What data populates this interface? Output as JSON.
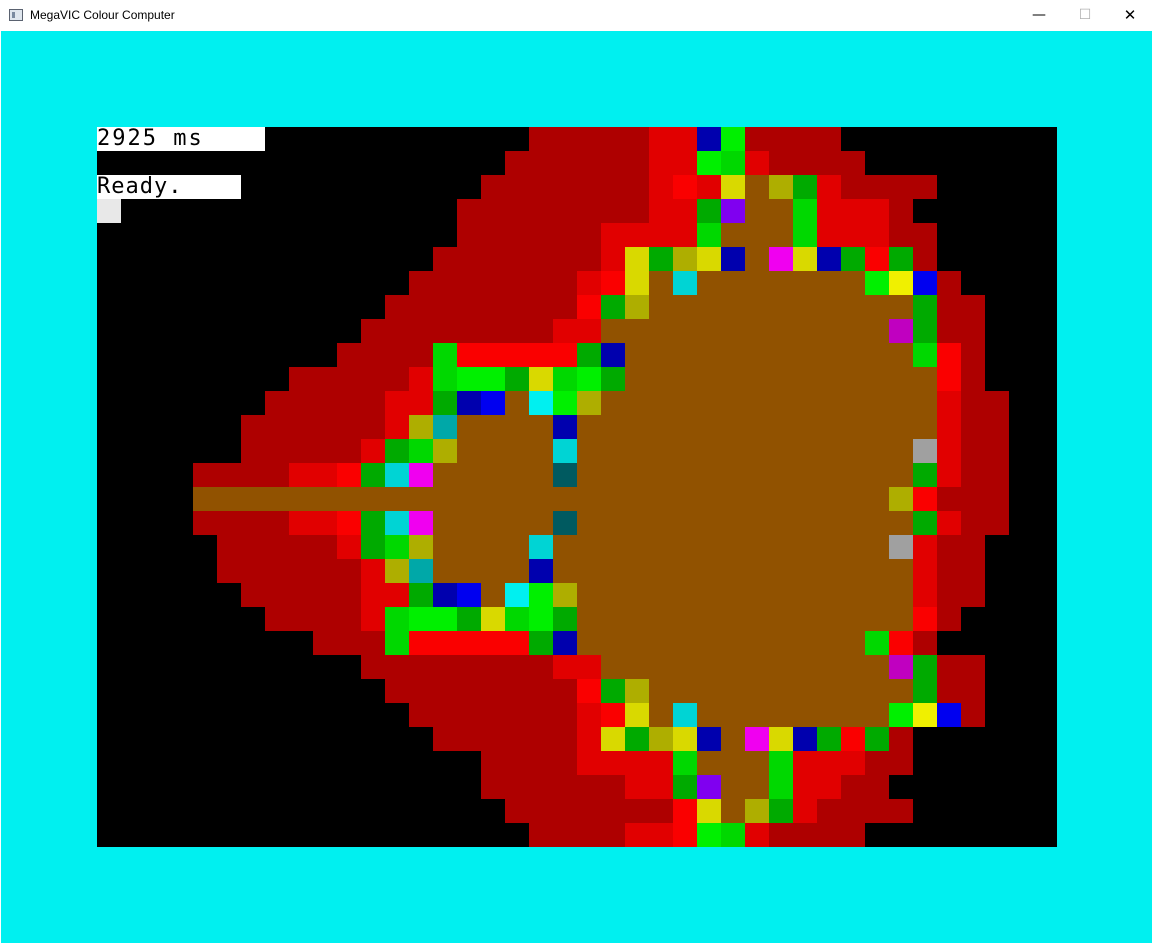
{
  "window": {
    "title": "MegaVIC Colour Computer",
    "icon": "app-window-icon",
    "controls": {
      "minimize_glyph": "—",
      "maximize_glyph": "☐",
      "close_glyph": "✕"
    }
  },
  "screen": {
    "border_color": "#00f0f0",
    "background_color": "#000000",
    "timing_text": "2925 ms",
    "status_text": "Ready.",
    "palette": {
      "K": "#000000",
      "D": "#ae0000",
      "r": "#c80000",
      "R": "#e10000",
      "E": "#fa0000",
      "B": "#915200",
      "Y": "#aeae00",
      "y": "#d9d900",
      "L": "#f0f000",
      "G": "#00aa00",
      "g": "#00d800",
      "l": "#00f000",
      "N": "#0000ae",
      "U": "#0000f0",
      "C": "#00a8a8",
      "c": "#00d4d4",
      "A": "#00f0f0",
      "T": "#005a60",
      "M": "#c000c0",
      "m": "#f000f0",
      "P": "#8000f0",
      "W": "#a0a0a0"
    },
    "fractal_rows": [
      "KKKKKKKKKKKKKKKKKKKKDDDDDRRNlDDDDKKKKKKKKKKKKKKK",
      "KKKKKKKKKKKKKKKKKKKDDDDDDRRlgRDDDDKKKKKKKKKKKKKK",
      "KKKKKKKKKKKKKKKKKKDDDDDDDRERyBYGRDDDDKKKKKKKKKKK",
      "KKKKKKKKKKKKKKKKKDDDDDDDDRRGPBBgRRRDKKKKKKKKKKKK",
      "KKKKKKKKKKKKKKKKKDDDDDDRRRRgBBBgRRRDDKKKKKKKKKKK",
      "KKKKKKKKKKKKKKKKDDDDDDDRyGYyNBmyNGEGDKKKKKKKKKKK",
      "KKKKKKKKKKKKKKKDDDDDDDREyBcBBBBBBBlLUDKKKKKKKKKK",
      "KKKKKKKKKKKKKKDDDDDDDDEGYBBBBBBBBBBBGDDKKKKKKKKK",
      "KKKKKKKKKKKKKDDDDDDDDRRBBBBBBBBBBBBMGDDKKKKKKKKK",
      "KKKKKKKKKKKKDDDDgEEEEEGNBBBBBBBBBBBBgEDKKKKKKKKK",
      "KKKKKKKKKKDDDDDRgllGyglGBBBBBBBBBBBBBEDKKKKKKKKK",
      "KKKKKKKKKDDDDDRRGNUBAlYBBBBBBBBBBBBBBRDDKKKKKKKK",
      "KKKKKKKKDDDDDDRYCBBBBNBBBBBBBBBBBBBBBRDDKKKKKKKK",
      "KKKKKKKKDDDDDRGgYBBBBcBBBBBBBBBBBBBBWRDDKKKKKKKK",
      "KKKKKKDDDDRREGcmBBBBBTBBBBBBBBBBBBBBGRDDKKKKKKKK",
      "KKKKKKBBBBBBBBBBBBBBBBBBBBBBBBBBBBBYEDDDKKKKKKKK",
      "KKKKKKDDDDRREGcmBBBBBTBBBBBBBBBBBBBBGRDDKKKKKKKK",
      "KKKKKKKDDDDDRGgYBBBBcBBBBBBBBBBBBBBWRDDKKKKKKKKK",
      "KKKKKKKDDDDDDRYCBBBBNBBBBBBBBBBBBBBBRDDKKKKKKKKK",
      "KKKKKKKKDDDDDRRGNUBAlYBBBBBBBBBBBBBBRDDKKKKKKKKK",
      "KKKKKKKKKDDDDRgllGyglGBBBBBBBBBBBBBBEDKKKKKKKKKK",
      "KKKKKKKKKKKDDDgEEEEEGNBBBBBBBBBBBBgEDKKKKKKKKKKK",
      "KKKKKKKKKKKKKDDDDDDDDRRBBBBBBBBBBBBMGDDKKKKKKKKK",
      "KKKKKKKKKKKKKKDDDDDDDDEGYBBBBBBBBBBBGDDKKKKKKKKK",
      "KKKKKKKKKKKKKKKDDDDDDDREyBcBBBBBBBBlLUDKKKKKKKKK",
      "KKKKKKKKKKKKKKKKDDDDDDRyGYyNBmyNGEGDKKKKKKKKKKKK",
      "KKKKKKKKKKKKKKKKKKDDDDRRRRgBBBgRRRDDKKKKKKKKKKKK",
      "KKKKKKKKKKKKKKKKKKDDDDDDRRGPBBgRRDDKKKKKKKKKKKKK",
      "KKKKKKKKKKKKKKKKKKKDDDDDDDEyBYGRDDDDKKKKKKKKKKKK",
      "KKKKKKKKKKKKKKKKKKKKDDDDRRElgRDDDDKKKKKKKKKKKKKK"
    ]
  }
}
